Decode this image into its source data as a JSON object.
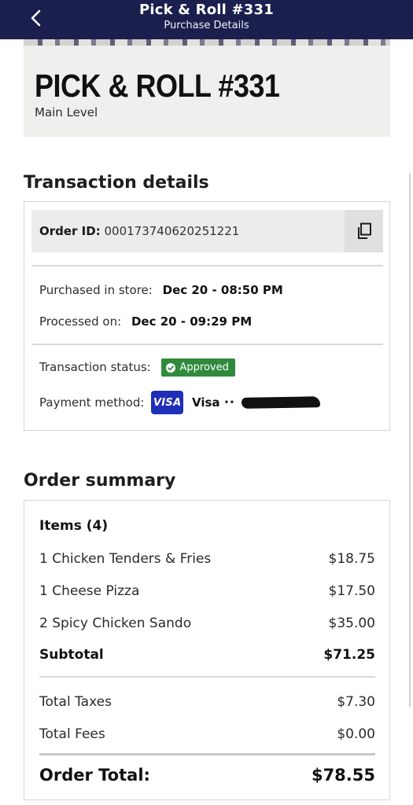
{
  "header": {
    "title": "Pick & Roll #331",
    "subtitle": "Purchase Details"
  },
  "hero": {
    "title": "PICK & ROLL #331",
    "level": "Main Level"
  },
  "transaction": {
    "section_title": "Transaction details",
    "order_id_label": "Order ID:",
    "order_id": "000173740620251221",
    "purchased_label": "Purchased in store:",
    "purchased_value": "Dec 20 - 08:50 PM",
    "processed_label": "Processed on:",
    "processed_value": "Dec 20 - 09:29 PM",
    "status_label": "Transaction status:",
    "status_value": "Approved",
    "payment_label": "Payment method:",
    "payment_brand": "VISA",
    "payment_name": "Visa",
    "masked_dots": "••"
  },
  "summary": {
    "section_title": "Order summary",
    "items_heading": "Items (4)",
    "items": [
      {
        "name": "1 Chicken Tenders & Fries",
        "price": "$18.75"
      },
      {
        "name": "1 Cheese Pizza",
        "price": "$17.50"
      },
      {
        "name": "2 Spicy Chicken Sando",
        "price": "$35.00"
      }
    ],
    "subtotal_label": "Subtotal",
    "subtotal": "$71.25",
    "taxes_label": "Total Taxes",
    "taxes": "$7.30",
    "fees_label": "Total Fees",
    "fees": "$0.00",
    "total_label": "Order Total:",
    "total": "$78.55"
  },
  "colors": {
    "header_bg": "#1a1f4e",
    "approved_green": "#2f8a3c",
    "visa_blue": "#1f2fb8"
  },
  "icons": {
    "back": "chevron-left-icon",
    "copy": "copy-icon",
    "approved": "check-circle-icon"
  }
}
